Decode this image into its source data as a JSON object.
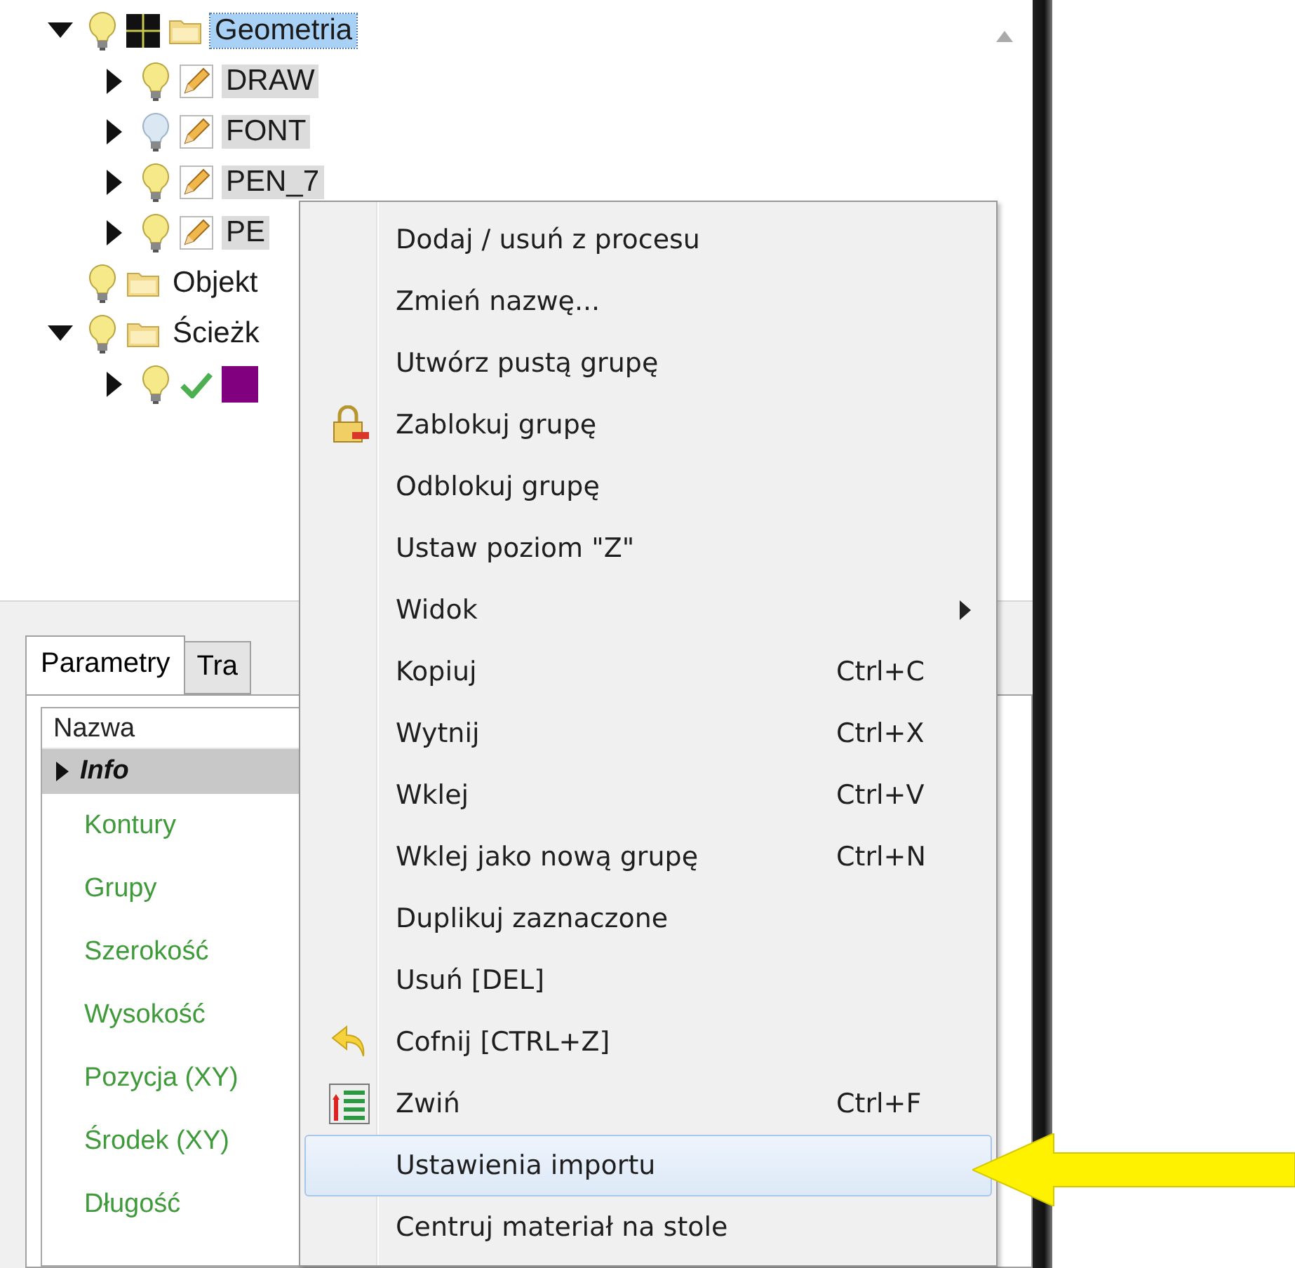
{
  "tree": [
    {
      "label": "Geometria",
      "kind": "group",
      "on": true,
      "expanded": true,
      "selected": true,
      "children": [
        {
          "label": "DRAW",
          "kind": "layer",
          "on": true,
          "expanded": false,
          "selected": false
        },
        {
          "label": "FONT",
          "kind": "layer",
          "on": false,
          "expanded": false,
          "selected": false
        },
        {
          "label": "PEN_7",
          "kind": "layer",
          "on": true,
          "expanded": false,
          "selected": false
        },
        {
          "label": "PE",
          "kind": "layer",
          "on": true,
          "expanded": false,
          "selected": false
        }
      ]
    },
    {
      "label": "Objekt",
      "kind": "folder",
      "on": true,
      "selected": false
    },
    {
      "label": "Ścieżk",
      "kind": "folder",
      "on": true,
      "expanded": true,
      "selected": false,
      "children": [
        {
          "kind": "path",
          "on": true,
          "expanded": false,
          "selected": false,
          "color": "#800080"
        }
      ]
    }
  ],
  "tabs": [
    {
      "label": "Parametry",
      "selected": true
    },
    {
      "label": "Tra",
      "selected": false
    }
  ],
  "properties": {
    "header": "Nazwa",
    "rows": [
      {
        "label": "Info",
        "kind": "category",
        "expanded": false
      },
      {
        "label": "Kontury",
        "kind": "property"
      },
      {
        "label": "Grupy",
        "kind": "property"
      },
      {
        "label": "Szerokość",
        "kind": "property"
      },
      {
        "label": "Wysokość",
        "kind": "property"
      },
      {
        "label": "Pozycja (XY)",
        "kind": "property"
      },
      {
        "label": "Środek (XY)",
        "kind": "property"
      },
      {
        "label": "Długość",
        "kind": "property"
      }
    ]
  },
  "context_menu": [
    {
      "label": "Dodaj / usuń z procesu",
      "kind": "plain",
      "selected": false
    },
    {
      "label": "Zmień nazwę...",
      "kind": "plain",
      "selected": false
    },
    {
      "label": "Utwórz pustą grupę",
      "kind": "plain",
      "selected": false
    },
    {
      "label": "Zablokuj grupę",
      "kind": "lock",
      "selected": false
    },
    {
      "label": "Odblokuj grupę",
      "kind": "plain",
      "selected": false
    },
    {
      "label": "Ustaw poziom \"Z\"",
      "kind": "plain",
      "selected": false
    },
    {
      "label": "Widok",
      "kind": "submenu",
      "selected": false
    },
    {
      "label": "Kopiuj",
      "kind": "plain",
      "shortcut": "Ctrl+C",
      "selected": false
    },
    {
      "label": "Wytnij",
      "kind": "plain",
      "shortcut": "Ctrl+X",
      "selected": false
    },
    {
      "label": "Wklej",
      "kind": "plain",
      "shortcut": "Ctrl+V",
      "selected": false
    },
    {
      "label": "Wklej jako nową grupę",
      "kind": "plain",
      "shortcut": "Ctrl+N",
      "selected": false
    },
    {
      "label": "Duplikuj zaznaczone",
      "kind": "plain",
      "selected": false
    },
    {
      "label": "Usuń [DEL]",
      "kind": "plain",
      "selected": false
    },
    {
      "label": "Cofnij [CTRL+Z]",
      "kind": "undo",
      "selected": false
    },
    {
      "label": "Zwiń",
      "kind": "collapse",
      "shortcut": "Ctrl+F",
      "selected": false
    },
    {
      "label": "Ustawienia importu",
      "kind": "plain",
      "selected": true
    },
    {
      "label": "Centruj materiał na stole",
      "kind": "plain",
      "selected": false
    }
  ]
}
